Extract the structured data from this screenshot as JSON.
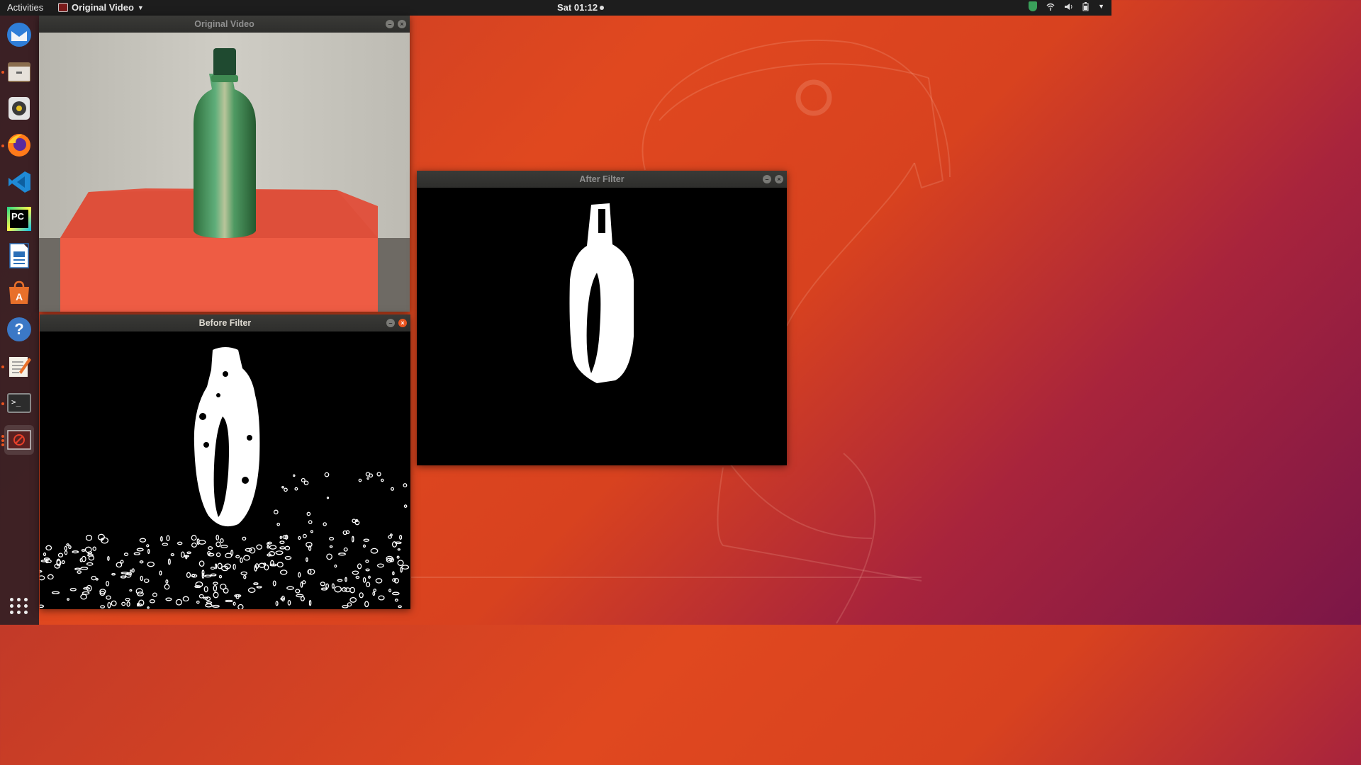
{
  "topbar": {
    "activities": "Activities",
    "app_menu": "Original Video",
    "clock": "Sat 01:12"
  },
  "dock": {
    "items": [
      {
        "icon": "thunderbird-icon"
      },
      {
        "icon": "files-icon"
      },
      {
        "icon": "rhythmbox-icon"
      },
      {
        "icon": "firefox-icon"
      },
      {
        "icon": "vscode-icon"
      },
      {
        "icon": "pycharm-icon",
        "label": "PC"
      },
      {
        "icon": "libreoffice-writer-icon"
      },
      {
        "icon": "software-center-icon"
      },
      {
        "icon": "help-icon",
        "label": "?"
      },
      {
        "icon": "text-editor-icon"
      },
      {
        "icon": "terminal-icon",
        "label": ">_"
      },
      {
        "icon": "opencv-window-icon"
      }
    ],
    "show_apps": "show-applications-icon"
  },
  "windows": {
    "original": {
      "title": "Original Video"
    },
    "before": {
      "title": "Before Filter"
    },
    "after": {
      "title": "After Filter"
    }
  },
  "colors": {
    "accent": "#e95420",
    "topbar": "#1d1d1d"
  }
}
